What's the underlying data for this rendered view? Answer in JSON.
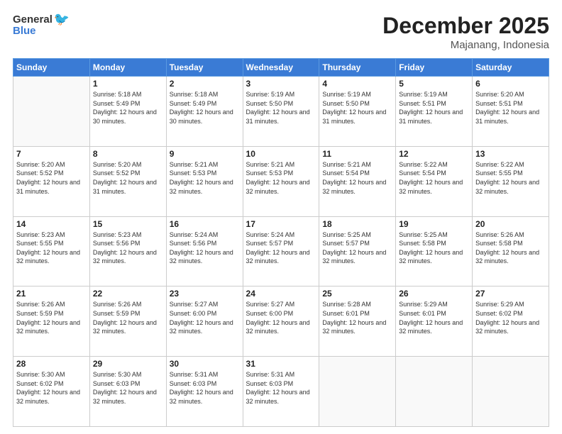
{
  "logo": {
    "general": "General",
    "blue": "Blue"
  },
  "header": {
    "month_year": "December 2025",
    "location": "Majanang, Indonesia"
  },
  "weekdays": [
    "Sunday",
    "Monday",
    "Tuesday",
    "Wednesday",
    "Thursday",
    "Friday",
    "Saturday"
  ],
  "weeks": [
    [
      {
        "day": "",
        "sunrise": "",
        "sunset": "",
        "daylight": ""
      },
      {
        "day": "1",
        "sunrise": "5:18 AM",
        "sunset": "5:49 PM",
        "daylight": "12 hours and 30 minutes."
      },
      {
        "day": "2",
        "sunrise": "5:18 AM",
        "sunset": "5:49 PM",
        "daylight": "12 hours and 30 minutes."
      },
      {
        "day": "3",
        "sunrise": "5:19 AM",
        "sunset": "5:50 PM",
        "daylight": "12 hours and 31 minutes."
      },
      {
        "day": "4",
        "sunrise": "5:19 AM",
        "sunset": "5:50 PM",
        "daylight": "12 hours and 31 minutes."
      },
      {
        "day": "5",
        "sunrise": "5:19 AM",
        "sunset": "5:51 PM",
        "daylight": "12 hours and 31 minutes."
      },
      {
        "day": "6",
        "sunrise": "5:20 AM",
        "sunset": "5:51 PM",
        "daylight": "12 hours and 31 minutes."
      }
    ],
    [
      {
        "day": "7",
        "sunrise": "5:20 AM",
        "sunset": "5:52 PM",
        "daylight": "12 hours and 31 minutes."
      },
      {
        "day": "8",
        "sunrise": "5:20 AM",
        "sunset": "5:52 PM",
        "daylight": "12 hours and 31 minutes."
      },
      {
        "day": "9",
        "sunrise": "5:21 AM",
        "sunset": "5:53 PM",
        "daylight": "12 hours and 32 minutes."
      },
      {
        "day": "10",
        "sunrise": "5:21 AM",
        "sunset": "5:53 PM",
        "daylight": "12 hours and 32 minutes."
      },
      {
        "day": "11",
        "sunrise": "5:21 AM",
        "sunset": "5:54 PM",
        "daylight": "12 hours and 32 minutes."
      },
      {
        "day": "12",
        "sunrise": "5:22 AM",
        "sunset": "5:54 PM",
        "daylight": "12 hours and 32 minutes."
      },
      {
        "day": "13",
        "sunrise": "5:22 AM",
        "sunset": "5:55 PM",
        "daylight": "12 hours and 32 minutes."
      }
    ],
    [
      {
        "day": "14",
        "sunrise": "5:23 AM",
        "sunset": "5:55 PM",
        "daylight": "12 hours and 32 minutes."
      },
      {
        "day": "15",
        "sunrise": "5:23 AM",
        "sunset": "5:56 PM",
        "daylight": "12 hours and 32 minutes."
      },
      {
        "day": "16",
        "sunrise": "5:24 AM",
        "sunset": "5:56 PM",
        "daylight": "12 hours and 32 minutes."
      },
      {
        "day": "17",
        "sunrise": "5:24 AM",
        "sunset": "5:57 PM",
        "daylight": "12 hours and 32 minutes."
      },
      {
        "day": "18",
        "sunrise": "5:25 AM",
        "sunset": "5:57 PM",
        "daylight": "12 hours and 32 minutes."
      },
      {
        "day": "19",
        "sunrise": "5:25 AM",
        "sunset": "5:58 PM",
        "daylight": "12 hours and 32 minutes."
      },
      {
        "day": "20",
        "sunrise": "5:26 AM",
        "sunset": "5:58 PM",
        "daylight": "12 hours and 32 minutes."
      }
    ],
    [
      {
        "day": "21",
        "sunrise": "5:26 AM",
        "sunset": "5:59 PM",
        "daylight": "12 hours and 32 minutes."
      },
      {
        "day": "22",
        "sunrise": "5:26 AM",
        "sunset": "5:59 PM",
        "daylight": "12 hours and 32 minutes."
      },
      {
        "day": "23",
        "sunrise": "5:27 AM",
        "sunset": "6:00 PM",
        "daylight": "12 hours and 32 minutes."
      },
      {
        "day": "24",
        "sunrise": "5:27 AM",
        "sunset": "6:00 PM",
        "daylight": "12 hours and 32 minutes."
      },
      {
        "day": "25",
        "sunrise": "5:28 AM",
        "sunset": "6:01 PM",
        "daylight": "12 hours and 32 minutes."
      },
      {
        "day": "26",
        "sunrise": "5:29 AM",
        "sunset": "6:01 PM",
        "daylight": "12 hours and 32 minutes."
      },
      {
        "day": "27",
        "sunrise": "5:29 AM",
        "sunset": "6:02 PM",
        "daylight": "12 hours and 32 minutes."
      }
    ],
    [
      {
        "day": "28",
        "sunrise": "5:30 AM",
        "sunset": "6:02 PM",
        "daylight": "12 hours and 32 minutes."
      },
      {
        "day": "29",
        "sunrise": "5:30 AM",
        "sunset": "6:03 PM",
        "daylight": "12 hours and 32 minutes."
      },
      {
        "day": "30",
        "sunrise": "5:31 AM",
        "sunset": "6:03 PM",
        "daylight": "12 hours and 32 minutes."
      },
      {
        "day": "31",
        "sunrise": "5:31 AM",
        "sunset": "6:03 PM",
        "daylight": "12 hours and 32 minutes."
      },
      {
        "day": "",
        "sunrise": "",
        "sunset": "",
        "daylight": ""
      },
      {
        "day": "",
        "sunrise": "",
        "sunset": "",
        "daylight": ""
      },
      {
        "day": "",
        "sunrise": "",
        "sunset": "",
        "daylight": ""
      }
    ]
  ],
  "labels": {
    "sunrise": "Sunrise:",
    "sunset": "Sunset:",
    "daylight": "Daylight:"
  }
}
